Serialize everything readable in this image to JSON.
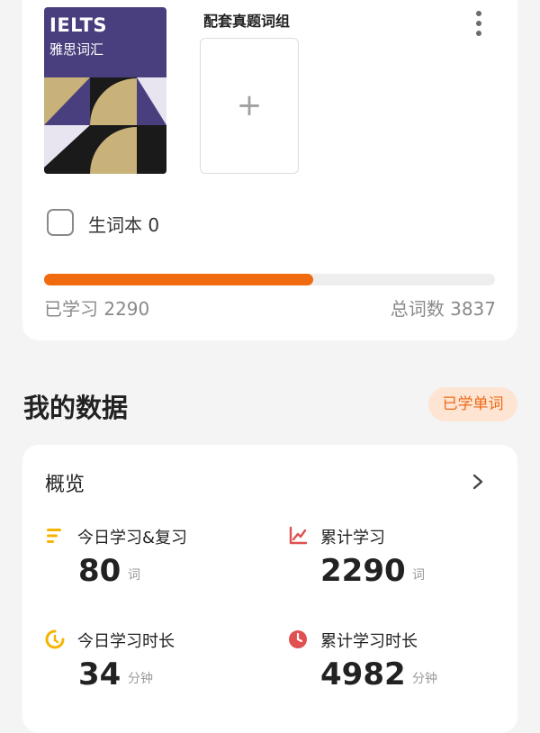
{
  "book": {
    "cover_brand": "IELTS",
    "cover_subtitle": "雅思词汇"
  },
  "slot": {
    "label": "配套真题词组",
    "add_symbol": "+"
  },
  "vocab_book": {
    "label": "生词本 0",
    "checked": false
  },
  "progress": {
    "fraction": 0.597,
    "learned_text": "已学习 2290",
    "total_text": "总词数 3837"
  },
  "my_data": {
    "title": "我的数据",
    "tag": "已学单词"
  },
  "overview": {
    "title": "概览",
    "stats": [
      {
        "label": "今日学习&复习",
        "value": "80",
        "unit": "词",
        "icon": "bars-icon",
        "color": "#f5b400"
      },
      {
        "label": "累计学习",
        "value": "2290",
        "unit": "词",
        "icon": "trend-icon",
        "color": "#e05050"
      },
      {
        "label": "今日学习时长",
        "value": "34",
        "unit": "分钟",
        "icon": "moon-clock-icon",
        "color": "#f5b400"
      },
      {
        "label": "累计学习时长",
        "value": "4982",
        "unit": "分钟",
        "icon": "clock-icon",
        "color": "#e05050"
      }
    ]
  }
}
